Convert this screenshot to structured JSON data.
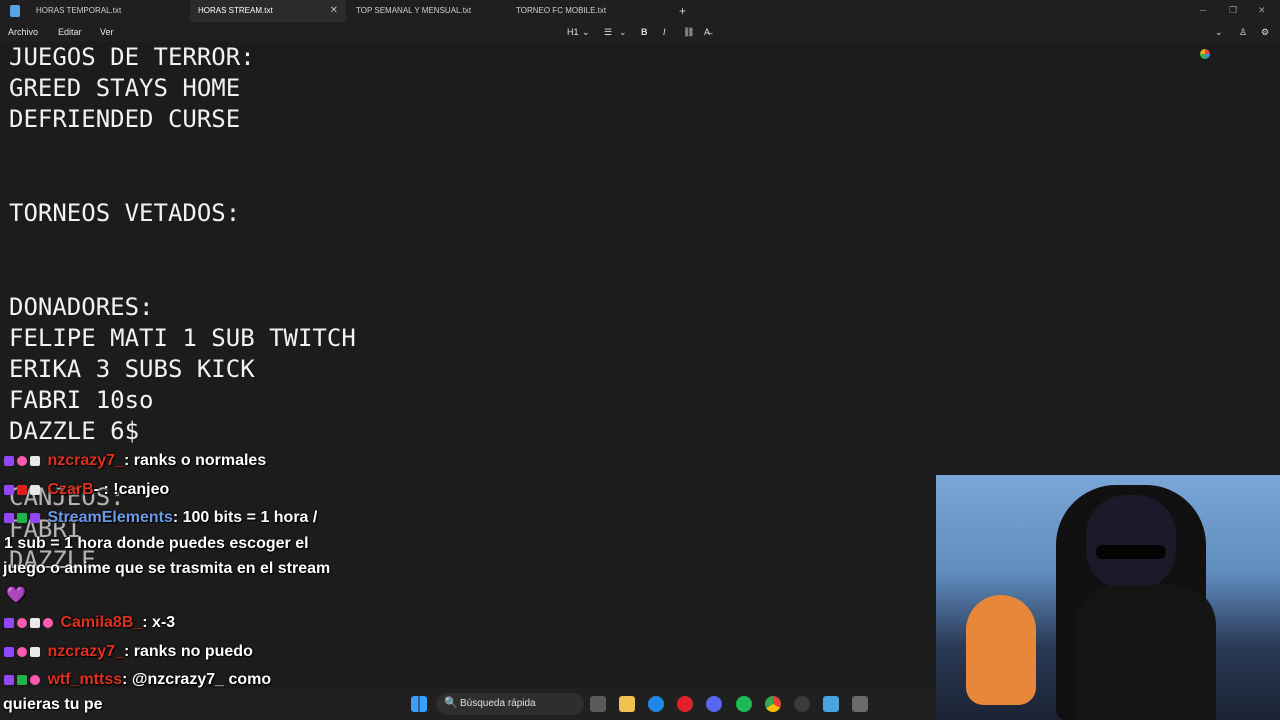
{
  "tabs": [
    {
      "label": "HORAS TEMPORAL.txt",
      "active": false
    },
    {
      "label": "HORAS STREAM.txt",
      "active": true
    },
    {
      "label": "TOP SEMANAL Y MENSUAL.txt",
      "active": false
    },
    {
      "label": "TORNEO FC MOBILE.txt",
      "active": false
    }
  ],
  "tab_close_glyph": "✕",
  "new_tab_glyph": "+",
  "menu": {
    "file": "Archivo",
    "edit": "Editar",
    "view": "Ver"
  },
  "toolbar": {
    "heading": "H1",
    "heading_chevron": "⌄",
    "list": "☰",
    "list_chevron": "⌄",
    "bold": "B",
    "italic": "I",
    "link": "⛓",
    "clear_format": "A̶"
  },
  "document_lines": [
    "JUEGOS DE TERROR:",
    "GREED STAYS HOME",
    "DEFRIENDED CURSE",
    "TORNEOS VETADOS:",
    "DONADORES:",
    "FELIPE MATI 1 SUB TWITCH",
    "ERIKA 3 SUBS KICK",
    "FABRI 10so",
    "DAZZLE 6$",
    "CANJEOS:",
    "FABRI",
    "DAZZLE"
  ],
  "chat": [
    {
      "user": "nzcrazy7_",
      "text": ": ranks o normales"
    },
    {
      "user": "CzarB",
      "text": "- : !canjeo"
    },
    {
      "user": "StreamElements",
      "text": ": 100 bits = 1 hora /"
    },
    {
      "user": "",
      "text": "1 sub = 1 hora donde puedes escoger el"
    },
    {
      "user": "",
      "text": "juego o anime que se trasmita en el stream"
    },
    {
      "user": "",
      "text": "💜"
    },
    {
      "user": "Camila8B_",
      "text": ": x-3"
    },
    {
      "user": "nzcrazy7_",
      "text": ": ranks no puedo"
    },
    {
      "user": "wtf_mttss",
      "text": ": @nzcrazy7_ como"
    },
    {
      "user": "",
      "text": "quieras tu pe"
    }
  ],
  "taskbar": {
    "search_placeholder": "Búsqueda rápida"
  },
  "colors": {
    "background": "#1c1c1c",
    "chat_user": "#e0301e",
    "streamelements": "#6a9ae8",
    "twitch_badge": "#9146ff"
  }
}
